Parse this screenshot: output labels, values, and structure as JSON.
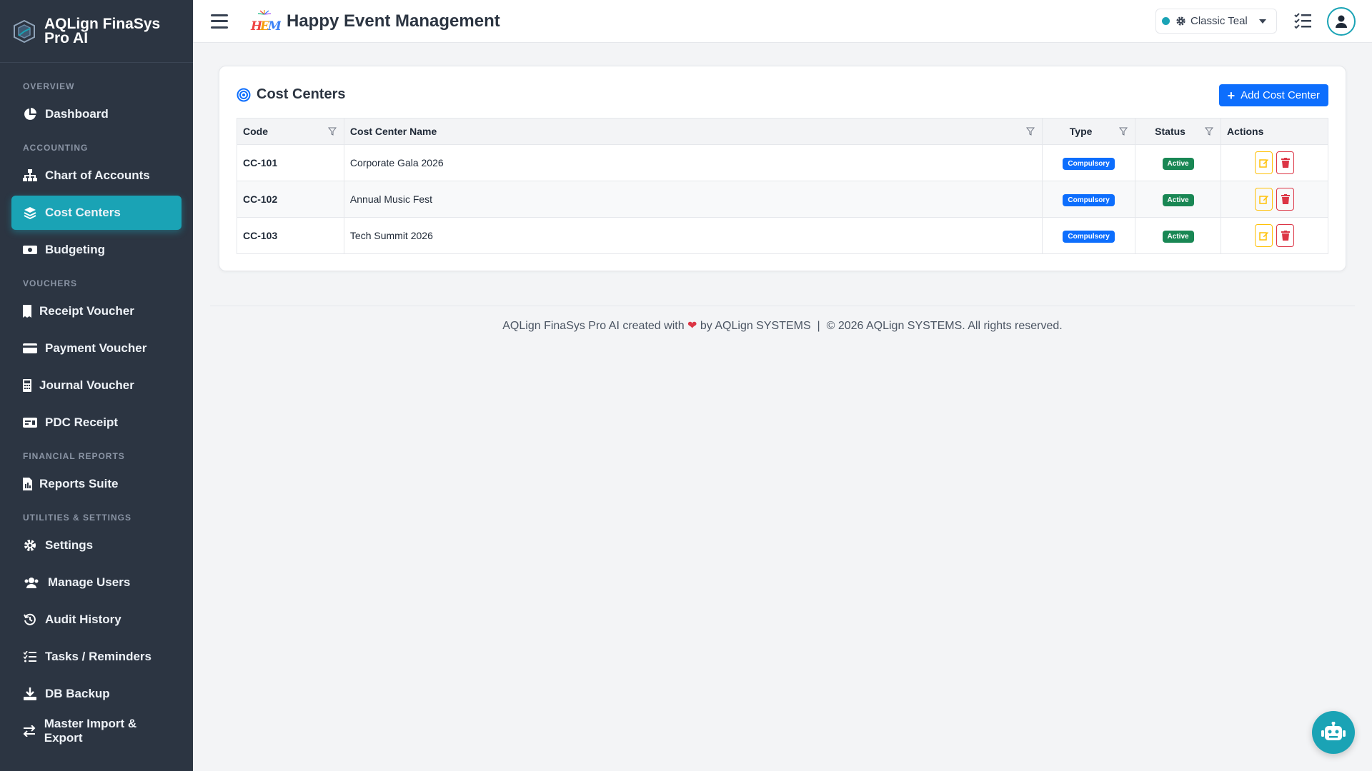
{
  "brand": {
    "name": "AQLign FinaSys Pro AI"
  },
  "header": {
    "title": "Happy Event Management",
    "theme_label": "Classic Teal",
    "theme_color": "#1aa3b5"
  },
  "sidebar": {
    "sections": [
      {
        "title": "OVERVIEW",
        "items": [
          {
            "label": "Dashboard",
            "icon": "chart-pie-icon"
          }
        ]
      },
      {
        "title": "ACCOUNTING",
        "items": [
          {
            "label": "Chart of Accounts",
            "icon": "sitemap-icon"
          },
          {
            "label": "Cost Centers",
            "icon": "layers-icon",
            "active": true
          },
          {
            "label": "Budgeting",
            "icon": "money-icon"
          }
        ]
      },
      {
        "title": "VOUCHERS",
        "items": [
          {
            "label": "Receipt Voucher",
            "icon": "receipt-icon"
          },
          {
            "label": "Payment Voucher",
            "icon": "credit-card-icon"
          },
          {
            "label": "Journal Voucher",
            "icon": "calculator-icon"
          },
          {
            "label": "PDC Receipt",
            "icon": "cheque-icon"
          }
        ]
      },
      {
        "title": "FINANCIAL REPORTS",
        "items": [
          {
            "label": "Reports Suite",
            "icon": "report-icon"
          }
        ]
      },
      {
        "title": "UTILITIES & SETTINGS",
        "items": [
          {
            "label": "Settings",
            "icon": "gear-icon"
          },
          {
            "label": "Manage Users",
            "icon": "users-icon"
          },
          {
            "label": "Audit History",
            "icon": "history-icon"
          },
          {
            "label": "Tasks / Reminders",
            "icon": "list-check-icon"
          },
          {
            "label": "DB Backup",
            "icon": "download-icon"
          },
          {
            "label": "Master Import & Export",
            "icon": "swap-icon"
          }
        ]
      }
    ]
  },
  "card": {
    "title": "Cost Centers",
    "add_button": "Add Cost Center",
    "columns": [
      "Code",
      "Cost Center Name",
      "Type",
      "Status",
      "Actions"
    ],
    "rows": [
      {
        "code": "CC-101",
        "name": "Corporate Gala 2026",
        "type": "Compulsory",
        "status": "Active"
      },
      {
        "code": "CC-102",
        "name": "Annual Music Fest",
        "type": "Compulsory",
        "status": "Active"
      },
      {
        "code": "CC-103",
        "name": "Tech Summit 2026",
        "type": "Compulsory",
        "status": "Active"
      }
    ]
  },
  "footer": {
    "part1": "AQLign FinaSys Pro AI created with",
    "part2": "by AQLign SYSTEMS",
    "separator": "|",
    "copyright": "© 2026 AQLign SYSTEMS. All rights reserved."
  }
}
